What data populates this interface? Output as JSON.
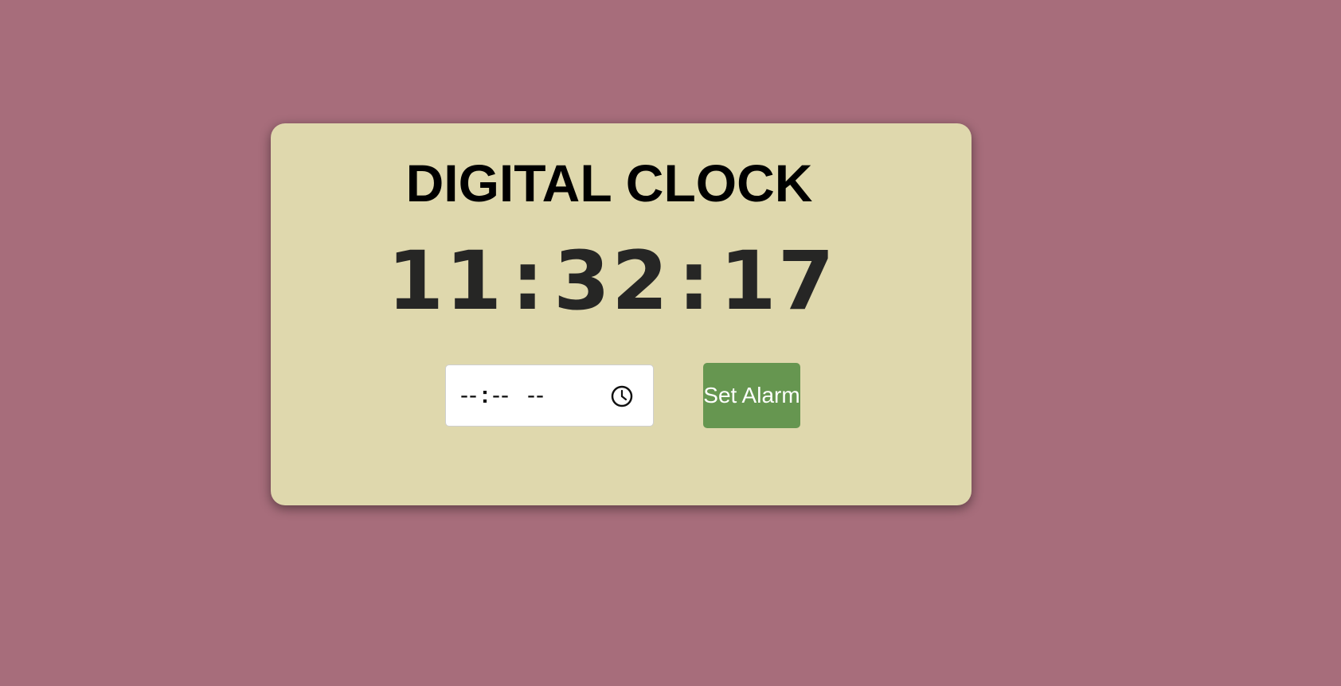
{
  "clock": {
    "title": "DIGITAL CLOCK",
    "hours": "11",
    "minutes": "32",
    "seconds": "17",
    "separator": ":"
  },
  "alarm": {
    "hour_placeholder": "--",
    "minute_placeholder": "--",
    "ampm_placeholder": "--",
    "separator": ":",
    "value": "",
    "icon": "clock-icon",
    "button_label": "Set Alarm"
  },
  "colors": {
    "background": "#a76d7b",
    "card": "#dfd8ad",
    "button": "#669650",
    "time_text": "#262625"
  }
}
